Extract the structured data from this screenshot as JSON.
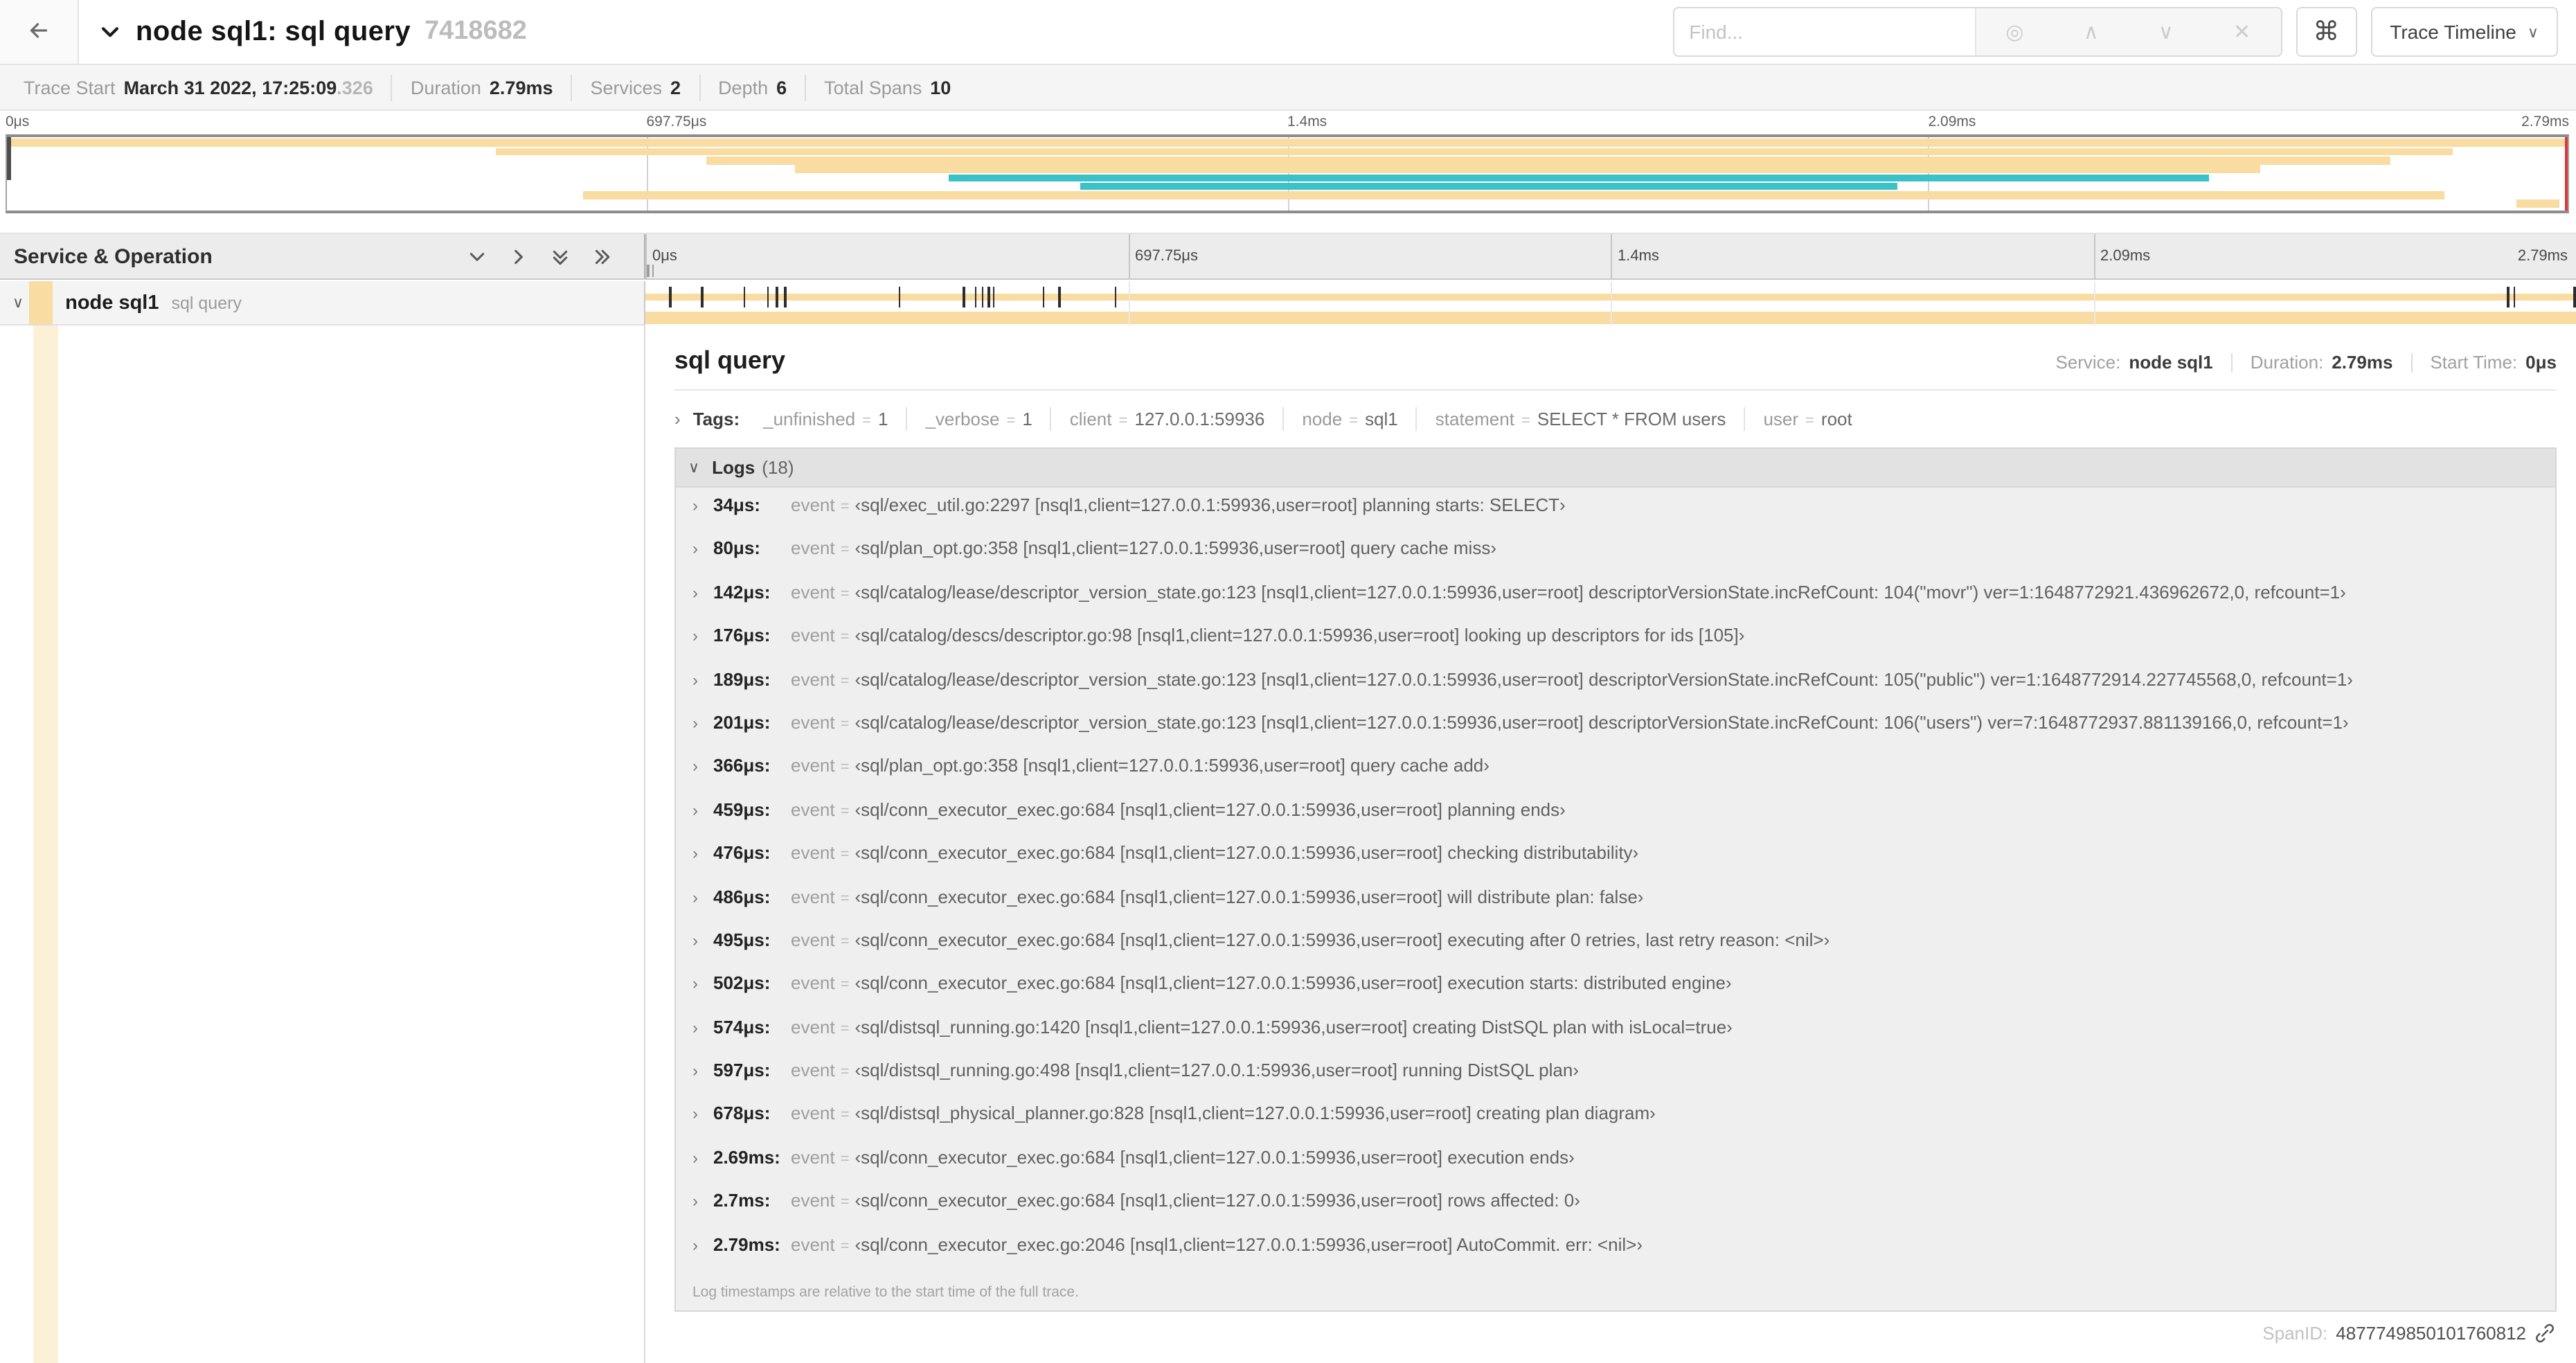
{
  "colors": {
    "tan": "#F8DCA1",
    "tan_light": "#FCF1D7",
    "teal": "#3BC2C8",
    "scrub_red": "#D9363E"
  },
  "header": {
    "title": "node sql1: sql query",
    "trace_id": "7418682",
    "find_placeholder": "Find...",
    "view_label": "Trace Timeline"
  },
  "summary": {
    "items": [
      {
        "label": "Trace Start",
        "value": "March 31 2022, 17:25:09",
        "suffix": ".326"
      },
      {
        "label": "Duration",
        "value": "2.79ms"
      },
      {
        "label": "Services",
        "value": "2"
      },
      {
        "label": "Depth",
        "value": "6"
      },
      {
        "label": "Total Spans",
        "value": "10"
      }
    ]
  },
  "minimap": {
    "labels": [
      {
        "text": "0μs",
        "pos": 0
      },
      {
        "text": "697.75μs",
        "pos": 25
      },
      {
        "text": "1.4ms",
        "pos": 50
      },
      {
        "text": "2.09ms",
        "pos": 75
      },
      {
        "text": "2.79ms",
        "pos": 100,
        "align": "right"
      }
    ],
    "spans": [
      {
        "color": "tan",
        "start": 0,
        "end": 100
      },
      {
        "color": "tan",
        "start": 19.1,
        "end": 95.5
      },
      {
        "color": "tan",
        "start": 27.3,
        "end": 93.1
      },
      {
        "color": "tan",
        "start": 30.8,
        "end": 88.0
      },
      {
        "color": "teal",
        "start": 36.8,
        "end": 86.0
      },
      {
        "color": "teal",
        "start": 41.9,
        "end": 73.8
      },
      {
        "color": "tan",
        "start": 22.5,
        "end": 95.2
      },
      {
        "color": "tan",
        "start": 98.0,
        "end": 99.7
      }
    ]
  },
  "timeline": {
    "header": "Service & Operation",
    "ruler": [
      {
        "text": "0μs",
        "pos": 0
      },
      {
        "text": "697.75μs",
        "pos": 25
      },
      {
        "text": "1.4ms",
        "pos": 50
      },
      {
        "text": "2.09ms",
        "pos": 75
      },
      {
        "text": "2.79ms",
        "pos": 100,
        "align": "right"
      }
    ],
    "row": {
      "service": "node sql1",
      "operation": "sql query"
    },
    "log_ticks": [
      1.22,
      2.87,
      5.09,
      6.31,
      6.77,
      7.2,
      13.12,
      16.45,
      17.06,
      17.42,
      17.74,
      17.99,
      20.57,
      21.4,
      24.3,
      96.42,
      96.77,
      100
    ]
  },
  "detail": {
    "title": "sql query",
    "meta": [
      {
        "label": "Service:",
        "value": "node sql1"
      },
      {
        "label": "Duration:",
        "value": "2.79ms"
      },
      {
        "label": "Start Time:",
        "value": "0μs"
      }
    ],
    "tags_label": "Tags:",
    "tags": [
      {
        "key": "_unfinished",
        "value": "1"
      },
      {
        "key": "_verbose",
        "value": "1"
      },
      {
        "key": "client",
        "value": "127.0.0.1:59936"
      },
      {
        "key": "node",
        "value": "sql1"
      },
      {
        "key": "statement",
        "value": "SELECT * FROM users"
      },
      {
        "key": "user",
        "value": "root"
      }
    ],
    "logs_label": "Logs",
    "logs_count": "(18)",
    "logs": [
      {
        "time": "34μs:",
        "key": "event",
        "value": "‹sql/exec_util.go:2297 [nsql1,client=127.0.0.1:59936,user=root] planning starts: SELECT›"
      },
      {
        "time": "80μs:",
        "key": "event",
        "value": "‹sql/plan_opt.go:358 [nsql1,client=127.0.0.1:59936,user=root] query cache miss›"
      },
      {
        "time": "142μs:",
        "key": "event",
        "value": "‹sql/catalog/lease/descriptor_version_state.go:123 [nsql1,client=127.0.0.1:59936,user=root] descriptorVersionState.incRefCount: 104(\"movr\") ver=1:1648772921.436962672,0, refcount=1›"
      },
      {
        "time": "176μs:",
        "key": "event",
        "value": "‹sql/catalog/descs/descriptor.go:98 [nsql1,client=127.0.0.1:59936,user=root] looking up descriptors for ids [105]›"
      },
      {
        "time": "189μs:",
        "key": "event",
        "value": "‹sql/catalog/lease/descriptor_version_state.go:123 [nsql1,client=127.0.0.1:59936,user=root] descriptorVersionState.incRefCount: 105(\"public\") ver=1:1648772914.227745568,0, refcount=1›"
      },
      {
        "time": "201μs:",
        "key": "event",
        "value": "‹sql/catalog/lease/descriptor_version_state.go:123 [nsql1,client=127.0.0.1:59936,user=root] descriptorVersionState.incRefCount: 106(\"users\") ver=7:1648772937.881139166,0, refcount=1›"
      },
      {
        "time": "366μs:",
        "key": "event",
        "value": "‹sql/plan_opt.go:358 [nsql1,client=127.0.0.1:59936,user=root] query cache add›"
      },
      {
        "time": "459μs:",
        "key": "event",
        "value": "‹sql/conn_executor_exec.go:684 [nsql1,client=127.0.0.1:59936,user=root] planning ends›"
      },
      {
        "time": "476μs:",
        "key": "event",
        "value": "‹sql/conn_executor_exec.go:684 [nsql1,client=127.0.0.1:59936,user=root] checking distributability›"
      },
      {
        "time": "486μs:",
        "key": "event",
        "value": "‹sql/conn_executor_exec.go:684 [nsql1,client=127.0.0.1:59936,user=root] will distribute plan: false›"
      },
      {
        "time": "495μs:",
        "key": "event",
        "value": "‹sql/conn_executor_exec.go:684 [nsql1,client=127.0.0.1:59936,user=root] executing after 0 retries, last retry reason: <nil>›"
      },
      {
        "time": "502μs:",
        "key": "event",
        "value": "‹sql/conn_executor_exec.go:684 [nsql1,client=127.0.0.1:59936,user=root] execution starts: distributed engine›"
      },
      {
        "time": "574μs:",
        "key": "event",
        "value": "‹sql/distsql_running.go:1420 [nsql1,client=127.0.0.1:59936,user=root] creating DistSQL plan with isLocal=true›"
      },
      {
        "time": "597μs:",
        "key": "event",
        "value": "‹sql/distsql_running.go:498 [nsql1,client=127.0.0.1:59936,user=root] running DistSQL plan›"
      },
      {
        "time": "678μs:",
        "key": "event",
        "value": "‹sql/distsql_physical_planner.go:828 [nsql1,client=127.0.0.1:59936,user=root] creating plan diagram›"
      },
      {
        "time": "2.69ms:",
        "key": "event",
        "value": "‹sql/conn_executor_exec.go:684 [nsql1,client=127.0.0.1:59936,user=root] execution ends›"
      },
      {
        "time": "2.7ms:",
        "key": "event",
        "value": "‹sql/conn_executor_exec.go:684 [nsql1,client=127.0.0.1:59936,user=root] rows affected: 0›"
      },
      {
        "time": "2.79ms:",
        "key": "event",
        "value": "‹sql/conn_executor_exec.go:2046 [nsql1,client=127.0.0.1:59936,user=root] AutoCommit. err: <nil>›"
      }
    ],
    "logs_note": "Log timestamps are relative to the start time of the full trace.",
    "spanid_label": "SpanID:",
    "spanid": "4877749850101760812"
  }
}
